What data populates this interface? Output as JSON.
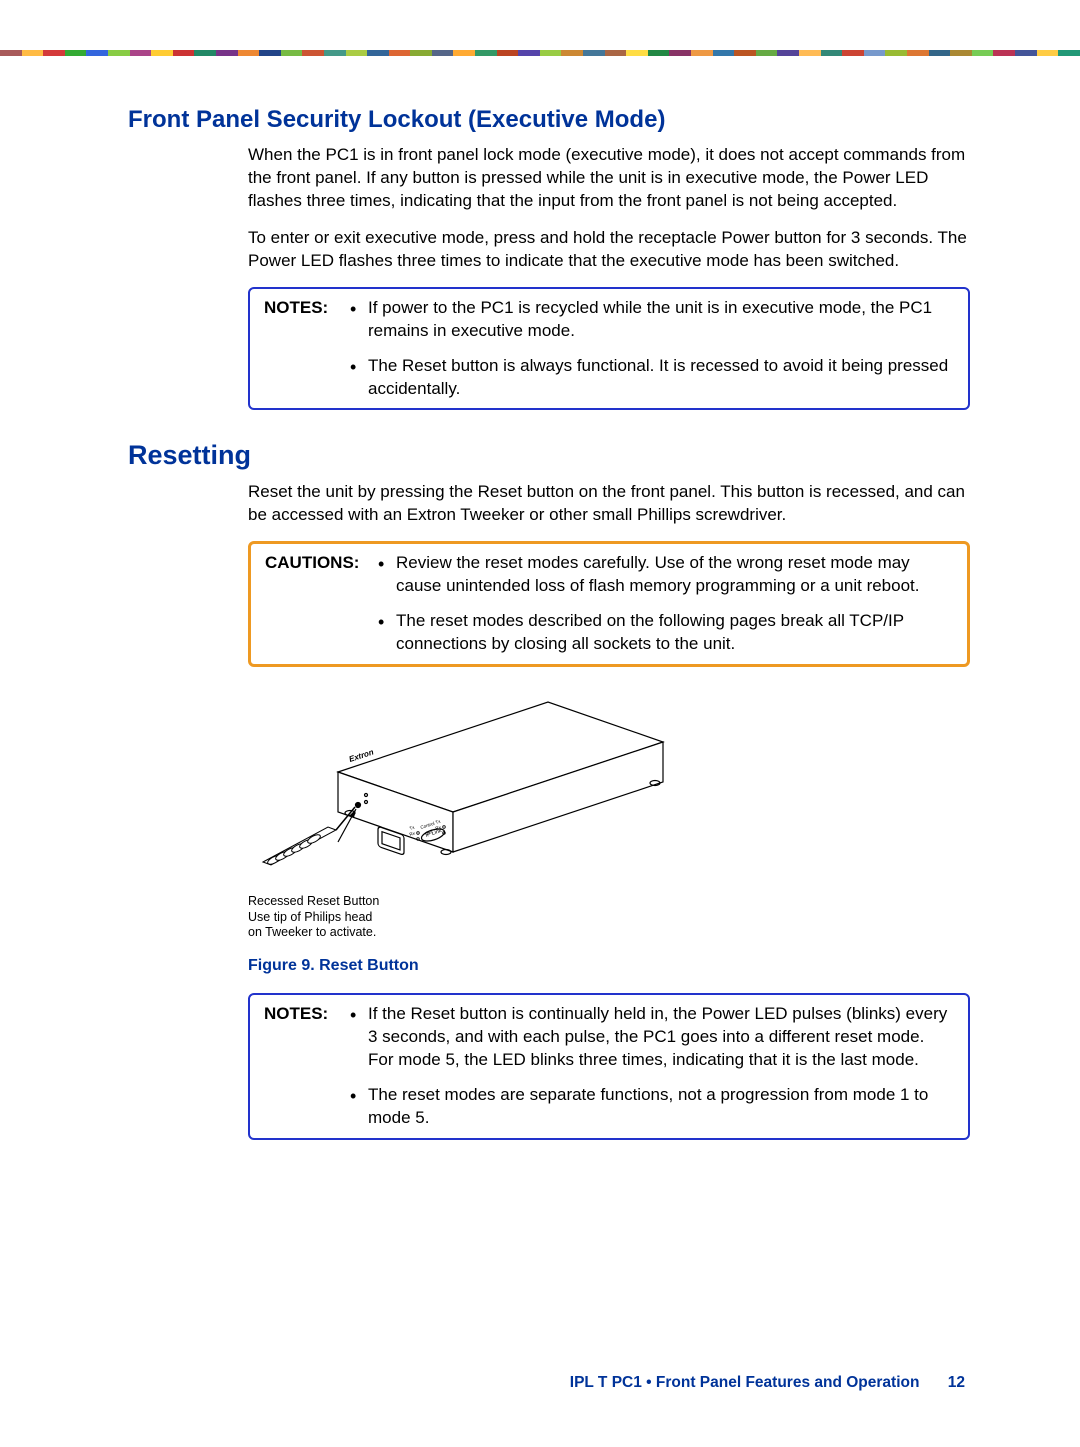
{
  "headings": {
    "front_panel": "Front Panel Security Lockout (Executive Mode)",
    "resetting": "Resetting"
  },
  "paragraphs": {
    "fp1": "When the PC1 is in front panel lock mode (executive mode), it does not accept commands from the front panel. If any button is pressed while the unit is in executive mode, the Power LED flashes three times, indicating that the input from the front panel is not being accepted.",
    "fp2": "To enter or exit executive mode, press and hold the receptacle Power button for 3 seconds. The Power LED flashes three times to indicate that the executive mode has been switched.",
    "reset1": "Reset the unit by pressing the Reset button on the front panel. This button is recessed, and can be accessed with an Extron Tweeker or other small Phillips screwdriver."
  },
  "notes_label": "NOTES:",
  "cautions_label": "CAUTIONS:",
  "notes1": {
    "item1": "If power to the PC1 is recycled while the unit is in executive mode, the PC1 remains in executive mode.",
    "item2": "The Reset button is always functional. It is recessed to avoid it being pressed accidentally."
  },
  "cautions1": {
    "item1": "Review the reset modes carefully. Use of the wrong reset mode may cause unintended loss of flash memory programming or a unit reboot.",
    "item2": "The reset modes described on the following pages break all TCP/IP connections by closing all sockets to the unit."
  },
  "notes2": {
    "item1": "If the Reset button is continually held in, the Power LED pulses (blinks) every 3 seconds, and with each pulse, the PC1 goes into a different reset mode. For mode 5, the LED blinks three times, indicating that it is the last mode.",
    "item2": "The reset modes are separate functions, not a progression from mode 1 to mode 5."
  },
  "diagram": {
    "caption_line1": "Recessed Reset Button",
    "caption_line2": "Use tip of Philips head",
    "caption_line3": "on Tweeker to activate.",
    "figure_label": "Figure 9.   Reset Button"
  },
  "footer": {
    "text": "IPL T PC1 • Front Panel Features and Operation",
    "page": "12"
  },
  "colors": {
    "heading_blue": "#003399",
    "note_border": "#2233cc",
    "caution_border": "#ee9922"
  }
}
